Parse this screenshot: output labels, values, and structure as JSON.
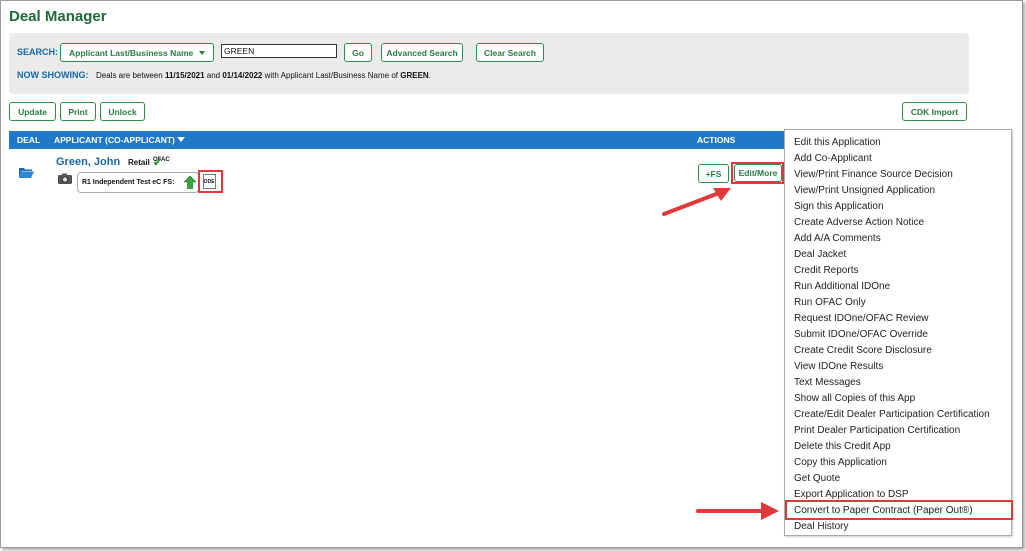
{
  "page": {
    "title": "Deal Manager"
  },
  "search": {
    "label": "SEARCH:",
    "field_select": "Applicant Last/Business Name",
    "value": "GREEN",
    "go": "Go",
    "advanced": "Advanced Search",
    "clear": "Clear Search"
  },
  "now_showing": {
    "label": "NOW SHOWING:",
    "text_1": "Deals are between ",
    "start_date": "11/15/2021",
    "text_2": " and ",
    "end_date": "01/14/2022",
    "text_3": " with Applicant Last/Business Name of ",
    "name": "GREEN",
    "text_4": "."
  },
  "toolbar": {
    "update": "Update",
    "print": "Print",
    "unlock": "Unlock",
    "cdk_import": "CDK Import"
  },
  "table": {
    "headers": {
      "deal": "DEAL",
      "applicant": "APPLICANT (CO-APPLICANT)",
      "actions": "ACTIONS"
    }
  },
  "deal": {
    "applicant_name": "Green, John",
    "type": "Retail",
    "ofac": "OFAC",
    "finance_source": "R1 Independent Test eC FS:",
    "doc_label": "DDE",
    "fs_button": "+FS",
    "edit_more_button": "Edit/More"
  },
  "menu": {
    "items": [
      "Edit this Application",
      "Add Co-Applicant",
      "View/Print Finance Source Decision",
      "View/Print Unsigned Application",
      "Sign this Application",
      "Create Adverse Action Notice",
      "Add A/A Comments",
      "Deal Jacket",
      "Credit Reports",
      "Run Additional IDOne",
      "Run OFAC Only",
      "Request IDOne/OFAC Review",
      "Submit IDOne/OFAC Override",
      "Create Credit Score Disclosure",
      "View IDOne Results",
      "Text Messages",
      "Show all Copies of this App",
      "Create/Edit Dealer Participation Certification",
      "Print Dealer Participation Certification",
      "Delete this Credit App",
      "Copy this Application",
      "Get Quote",
      "Export Application to DSP",
      "Convert to Paper Contract (Paper Out®)",
      "Deal History"
    ]
  },
  "colors": {
    "brand_green": "#1e6b3a",
    "button_green": "#2a7a43",
    "header_blue": "#1f79c6",
    "link_blue": "#1a66a8",
    "highlight_red": "#e0393b"
  }
}
